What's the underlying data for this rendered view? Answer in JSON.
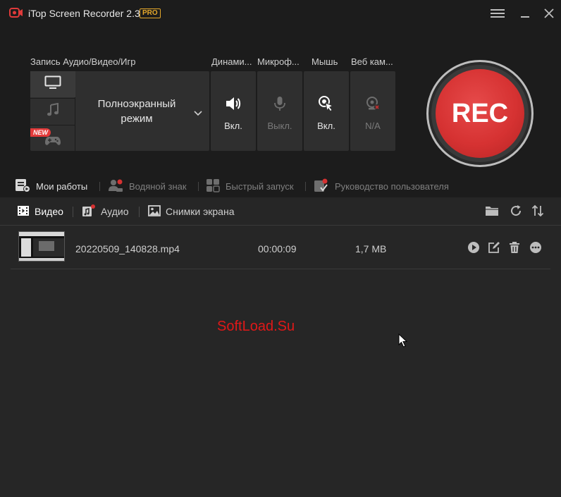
{
  "app": {
    "title": "iTop Screen Recorder 2.3",
    "badge": "PRO",
    "logo_icon": "camera-record-icon",
    "accent_color": "#d63232",
    "badge_color": "#e4a72a"
  },
  "window_controls": {
    "menu_icon": "hamburger-menu-icon",
    "minimize_icon": "minimize-icon",
    "close_icon": "close-icon"
  },
  "recording": {
    "group_labels": {
      "source": "Запись Аудио/Видео/Игр",
      "speaker": "Динами...",
      "microphone": "Микроф...",
      "mouse": "Мышь",
      "webcam": "Веб кам..."
    },
    "modes": [
      {
        "icon": "monitor-icon",
        "active": true
      },
      {
        "icon": "music-note-icon",
        "active": false
      },
      {
        "icon": "gamepad-icon",
        "active": false,
        "badge": "NEW"
      }
    ],
    "mode_select": {
      "label": "Полноэкранный режим",
      "icon": "chevron-down-icon"
    },
    "controls": {
      "speaker": {
        "icon": "speaker-icon",
        "state": "Вкл."
      },
      "microphone": {
        "icon": "microphone-icon",
        "state": "Выкл."
      },
      "mouse": {
        "icon": "mouse-click-icon",
        "state": "Вкл."
      },
      "webcam": {
        "icon": "webcam-icon",
        "state": "N/A"
      }
    },
    "rec_button": "REC"
  },
  "nav": [
    {
      "label": "Мои работы",
      "icon": "my-works-icon",
      "active": true
    },
    {
      "label": "Водяной знак",
      "icon": "watermark-icon",
      "active": false
    },
    {
      "label": "Быстрый запуск",
      "icon": "quick-launch-icon",
      "active": false
    },
    {
      "label": "Руководство пользователя",
      "icon": "user-guide-icon",
      "active": false
    }
  ],
  "tabs": [
    {
      "label": "Видео",
      "icon": "film-icon",
      "active": true
    },
    {
      "label": "Аудио",
      "icon": "audio-note-icon",
      "active": false
    },
    {
      "label": "Снимки экрана",
      "icon": "image-icon",
      "active": false
    }
  ],
  "toolbar": {
    "open_folder_icon": "folder-icon",
    "refresh_icon": "refresh-icon",
    "sort_icon": "sort-icon"
  },
  "files": [
    {
      "name": "20220509_140828.mp4",
      "duration": "00:00:09",
      "size": "1,7 MB",
      "actions": [
        "play-icon",
        "edit-icon",
        "trash-icon",
        "more-icon"
      ]
    }
  ],
  "watermark_text": "SoftLoad.Su"
}
